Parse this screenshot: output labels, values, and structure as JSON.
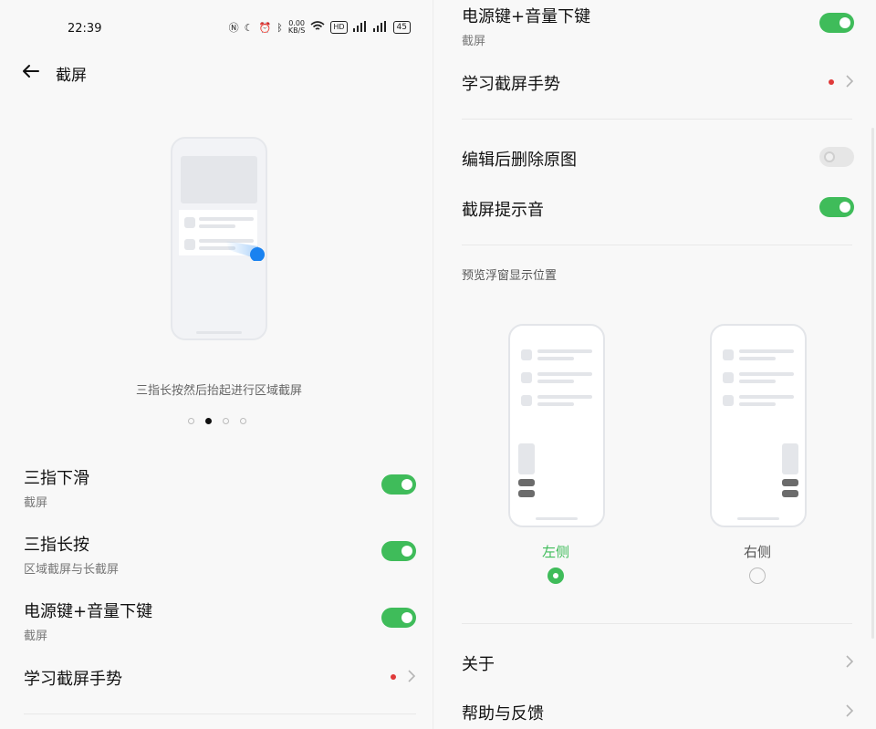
{
  "status_bar": {
    "time": "22:39",
    "speed": "0.00",
    "speed_unit": "KB/S",
    "hd": "HD",
    "battery": "45"
  },
  "header": {
    "title": "截屏"
  },
  "illustration": {
    "caption": "三指长按然后抬起进行区域截屏",
    "pager_count": 4,
    "pager_active": 1
  },
  "left_settings": [
    {
      "label": "三指下滑",
      "sub": "截屏",
      "on": true
    },
    {
      "label": "三指长按",
      "sub": "区域截屏与长截屏",
      "on": true
    },
    {
      "label": "电源键+音量下键",
      "sub": "截屏",
      "on": true
    }
  ],
  "left_learn": {
    "label": "学习截屏手势"
  },
  "right_top": {
    "label": "电源键+音量下键",
    "sub": "截屏",
    "on": true
  },
  "right_learn": {
    "label": "学习截屏手势"
  },
  "right_toggles": [
    {
      "label": "编辑后删除原图",
      "on": false
    },
    {
      "label": "截屏提示音",
      "on": true
    }
  ],
  "preview": {
    "section_title": "预览浮窗显示位置",
    "options": [
      {
        "label": "左侧",
        "selected": true
      },
      {
        "label": "右侧",
        "selected": false
      }
    ]
  },
  "links": [
    {
      "label": "关于"
    },
    {
      "label": "帮助与反馈"
    }
  ],
  "colors": {
    "accent": "#3fbc5a",
    "blue_dot": "#1a82f0",
    "red_dot": "#e03a3a"
  }
}
